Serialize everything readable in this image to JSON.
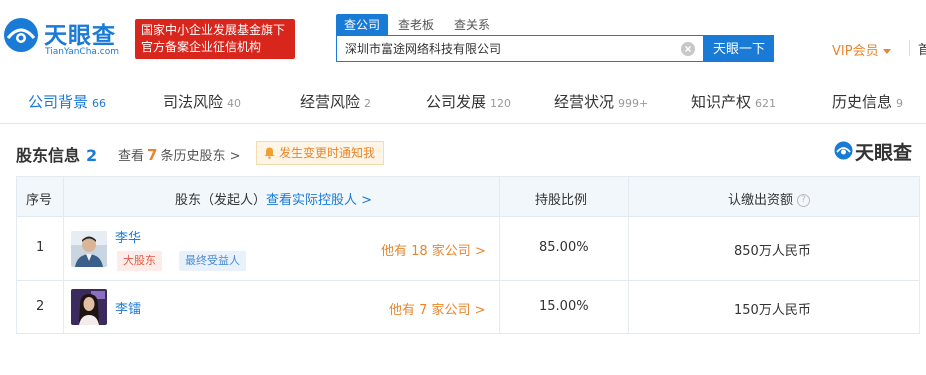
{
  "brand": {
    "name": "天眼查",
    "domain": "TianYanCha.com",
    "banner_line1": "国家中小企业发展基金旗下",
    "banner_line2": "官方备案企业征信机构",
    "accent": "#1a7bd6",
    "banner_color": "#d9261c"
  },
  "search": {
    "tabs": [
      "查公司",
      "查老板",
      "查关系"
    ],
    "active_tab": "查公司",
    "value": "深圳市富途网络科技有限公司",
    "button_label": "天眼一下"
  },
  "header": {
    "vip_label": "VIP会员",
    "more_label": "首"
  },
  "nav": {
    "items": [
      {
        "label": "公司背景",
        "count": "66",
        "active": true
      },
      {
        "label": "司法风险",
        "count": "40"
      },
      {
        "label": "经营风险",
        "count": "2"
      },
      {
        "label": "公司发展",
        "count": "120"
      },
      {
        "label": "经营状况",
        "count": "999+"
      },
      {
        "label": "知识产权",
        "count": "621"
      },
      {
        "label": "历史信息",
        "count": "9"
      }
    ]
  },
  "section": {
    "title": "股东信息",
    "count": "2",
    "history_prefix": "查看",
    "history_count": "7",
    "history_suffix": "条历史股东 >",
    "notify_label": "发生变更时通知我",
    "watermark": "天眼查"
  },
  "table": {
    "headers": {
      "index": "序号",
      "shareholder": "股东（发起人）",
      "controller_link": "查看实际控股人 >",
      "ratio": "持股比例",
      "capital": "认缴出资额"
    },
    "rows": [
      {
        "index": "1",
        "name": "李华",
        "tags": [
          "大股东",
          "最终受益人"
        ],
        "companies": "他有 18 家公司 >",
        "ratio": "85.00%",
        "capital": "850万人民币"
      },
      {
        "index": "2",
        "name": "李镭",
        "tags": [],
        "companies": "他有 7 家公司 >",
        "ratio": "15.00%",
        "capital": "150万人民币"
      }
    ]
  }
}
